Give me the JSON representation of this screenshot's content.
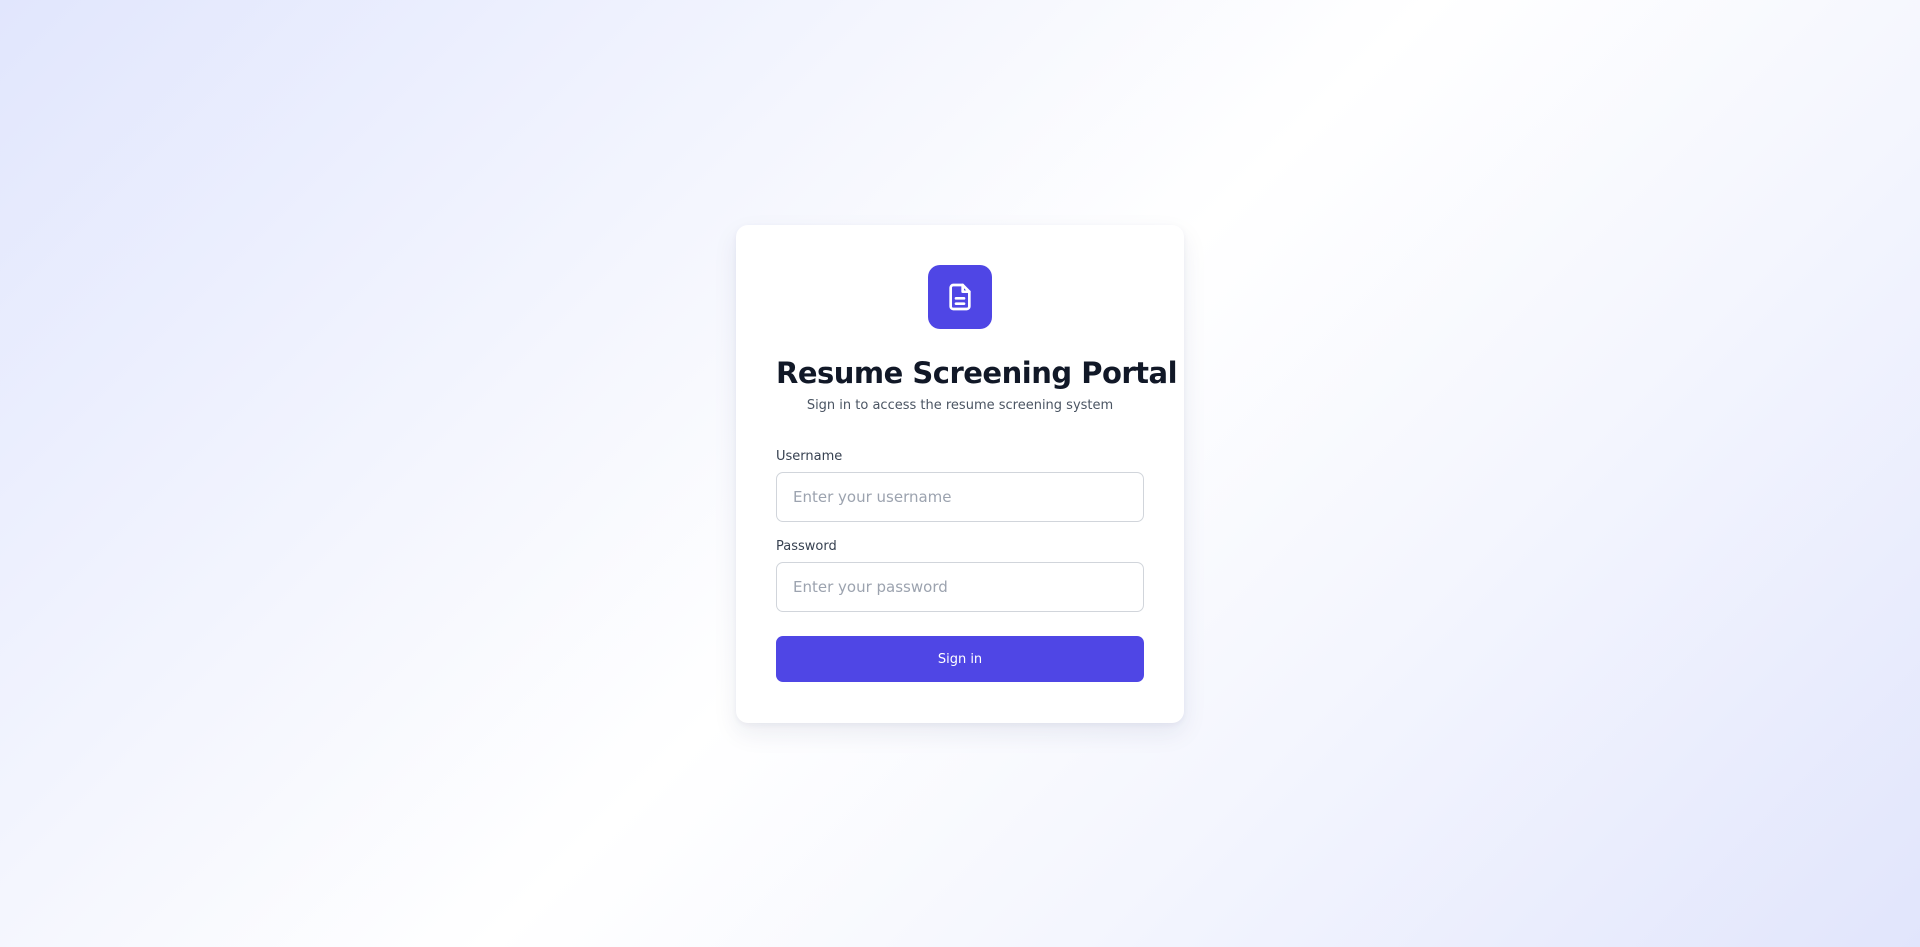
{
  "colors": {
    "accent": "#4f46e5",
    "title": "#111827",
    "muted": "#4b5563"
  },
  "logo": {
    "icon": "document-icon"
  },
  "header": {
    "title": "Resume Screening Portal",
    "subtitle": "Sign in to access the resume screening system"
  },
  "form": {
    "username": {
      "label": "Username",
      "value": "",
      "placeholder": "Enter your username"
    },
    "password": {
      "label": "Password",
      "value": "",
      "placeholder": "Enter your password"
    },
    "submit_label": "Sign in"
  }
}
